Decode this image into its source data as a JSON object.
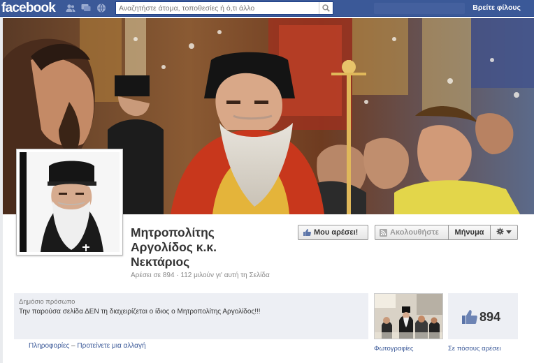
{
  "topbar": {
    "logo": "facebook",
    "search_placeholder": "Αναζητήστε άτομα, τοποθεσίες ή ό,τι άλλο",
    "find_friends": "Βρείτε φίλους",
    "icons": [
      "friend-requests-icon",
      "messages-icon",
      "notifications-icon",
      "search-icon"
    ]
  },
  "page": {
    "name_line1": "Μητροπολίτης",
    "name_line2": "Αργολίδος κ.κ.",
    "name_line3": "Νεκτάριος",
    "likes_line": "Αρέσει σε 894 · 112 μιλούν γι' αυτή τη Σελίδα"
  },
  "actions": {
    "like": "Μου αρέσει!",
    "follow": "Ακολουθήστε",
    "message": "Μήνυμα"
  },
  "about": {
    "category": "Δημόσιο πρόσωπο",
    "description": "Την παρούσα σελίδα ΔΕΝ τη διαχειρίζεται ο ίδιος ο Μητροπολίτης Αργολίδος!!!",
    "info_link": "Πληροφορίες",
    "sep": " – ",
    "suggest_link": "Προτείνετε μια αλλαγή"
  },
  "tiles": {
    "photos_label": "Φωτογραφίες",
    "likes_count": "894",
    "likes_label": "Σε πόσους αρέσει"
  },
  "colors": {
    "topbar": "#3b5998",
    "link": "#3b5998",
    "panel": "#edeff4"
  }
}
